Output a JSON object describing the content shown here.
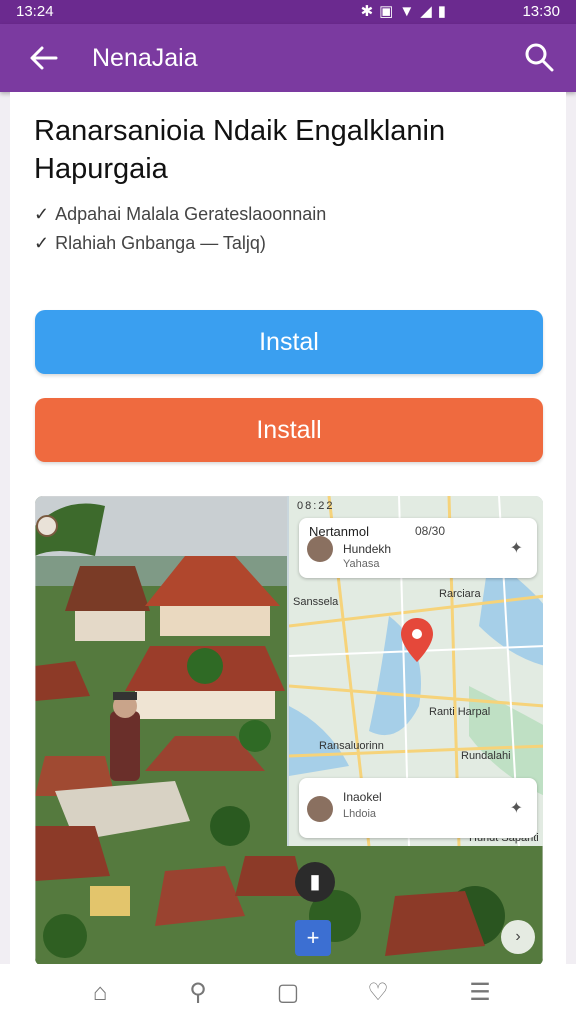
{
  "status_bar": {
    "time_left": "13:24",
    "time_right": "13:30",
    "icons": [
      "bluetooth-icon",
      "vibrate-icon",
      "wifi-icon",
      "signal-icon",
      "battery-icon"
    ]
  },
  "app_bar": {
    "title": "NenaJaia"
  },
  "app": {
    "title": "Ranarsanioia Ndaik Engalklanin Hapurgaia",
    "features": [
      "Adpahai Malala Gerateslaoonnain",
      "Rlahiah Gnbanga — Taljq)"
    ],
    "buttons": {
      "primary_label": "Instal",
      "secondary_label": "Install"
    }
  },
  "preview": {
    "status_time": "08:22",
    "map_card_top": {
      "title": "Nertanmol",
      "meta": "08/30",
      "name": "Hundekh",
      "sub": "Yahasa"
    },
    "map_labels": [
      "Sanssela",
      "Rarciara",
      "Ranti Harpal",
      "Ransaluorinn",
      "Rundalahi",
      "Hundt Sapanti"
    ],
    "map_card_bottom": {
      "name": "Inaokel",
      "sub": "Lhdoia"
    }
  },
  "bottom_nav": [
    "home-icon",
    "search-icon",
    "circle-icon",
    "heart-icon",
    "menu-icon"
  ],
  "colors": {
    "app_bar": "#7b3aa0",
    "status_bar": "#6b2a8f",
    "button_blue": "#3a9ff0",
    "button_orange": "#ef6a3f"
  }
}
